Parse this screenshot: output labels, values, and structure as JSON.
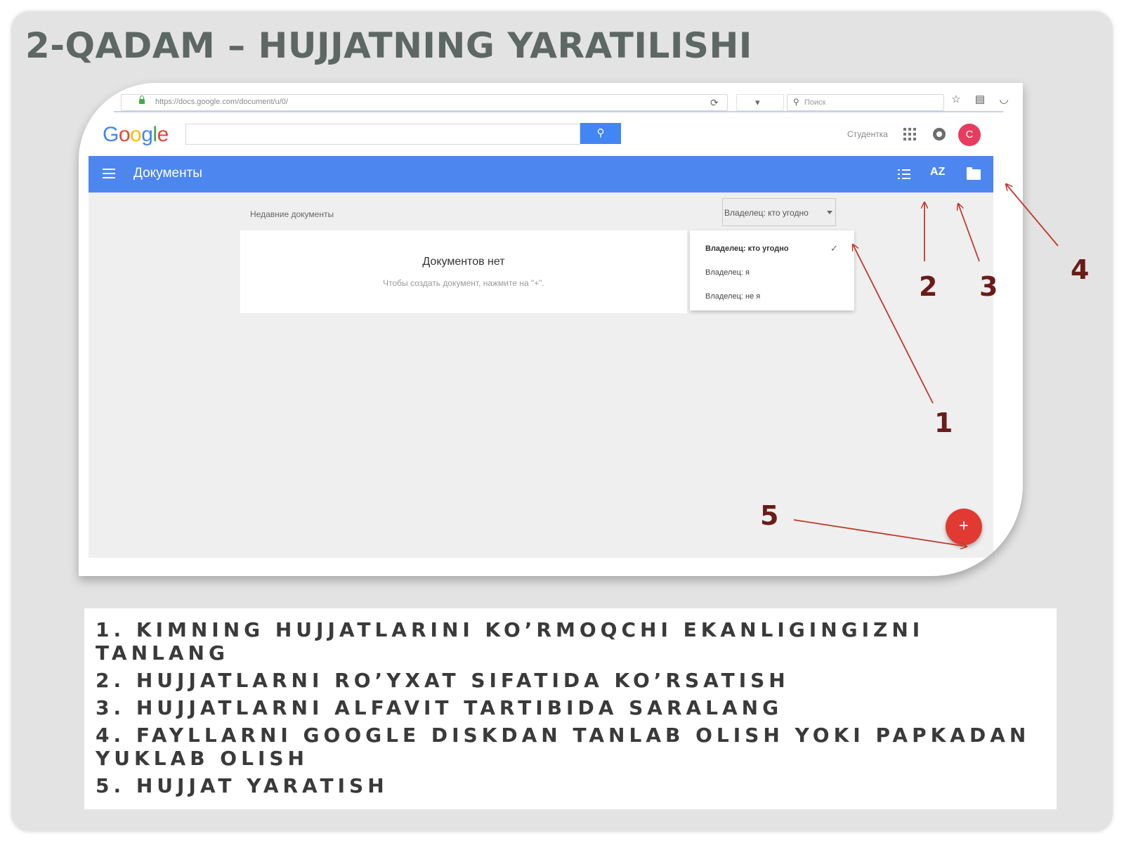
{
  "slide": {
    "title": "2-QADAM – HUJJATNING YARATILISHI"
  },
  "browser": {
    "url": "https://docs.google.com/document/u/0/",
    "search_placeholder": "Поиск",
    "icons": [
      "star-icon",
      "reading-list-icon",
      "pocket-icon",
      "download-icon",
      "home-icon",
      "smiley-icon",
      "menu-icon"
    ]
  },
  "google_bar": {
    "logo": "Google",
    "user_name": "Студентка",
    "avatar_letter": "C"
  },
  "app": {
    "title": "Документы",
    "recent_label": "Недавние документы",
    "owner_filter": "Владелец: кто угодно",
    "empty_title": "Документов нет",
    "empty_hint": "Чтобы создать документ, нажмите на \"+\".",
    "menu": [
      "Владелец: кто угодно",
      "Владелец: я",
      "Владелец: не я"
    ],
    "fab": "+"
  },
  "callouts": [
    "1",
    "2",
    "3",
    "4",
    "5"
  ],
  "steps": [
    "1. KIMNING HUJJATLARINI KO’RMOQCHI EKANLIGINGIZNI TANLANG",
    "2. HUJJATLARNI RO’YXAT SIFATIDA KO’RSATISH",
    "3. HUJJATLARNI ALFAVIT TARTIBIDA SARALANG",
    "4. FAYLLARNI GOOGLE DISKDAN TANLAB OLISH YOKI PAPKADAN YUKLAB OLISH",
    "5. HUJJAT YARATISH"
  ],
  "colors": {
    "title": "#5d6764",
    "appbar": "#4d86ef",
    "search_button": "#4285f4",
    "fab": "#e03a32",
    "avatar": "#e73c5f",
    "callout": "#6a1c1a",
    "arrow": "#c0392b"
  }
}
